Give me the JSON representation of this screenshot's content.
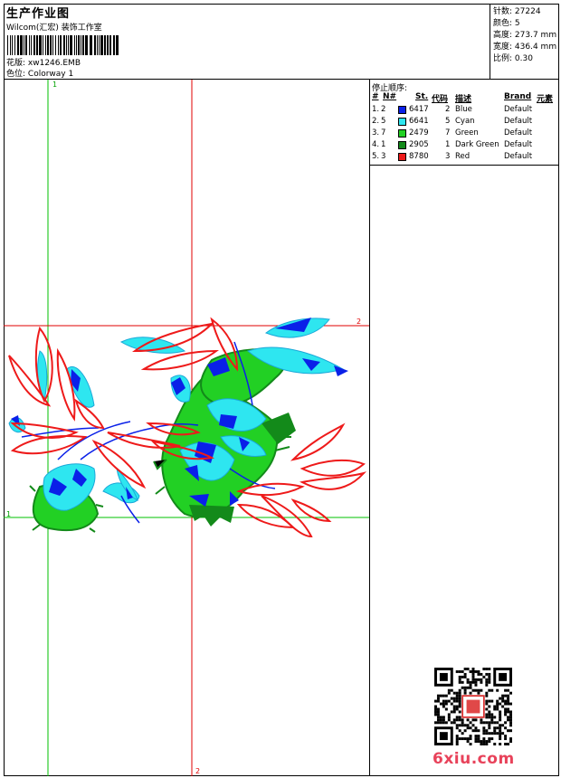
{
  "header": {
    "title": "生产作业图",
    "studio": "Wilcom(汇宏) 装饰工作室",
    "design_label": "花版:",
    "design_value": "xw1246.EMB",
    "colorway_label": "色位:",
    "colorway_value": "Colorway 1"
  },
  "stats": [
    {
      "label": "针数:",
      "value": "27224"
    },
    {
      "label": "颜色:",
      "value": "5"
    },
    {
      "label": "高度:",
      "value": "273.7 mm"
    },
    {
      "label": "宽度:",
      "value": "436.4 mm"
    },
    {
      "label": "比例:",
      "value": "0.30"
    }
  ],
  "stop_sequence": {
    "title": "停止顺序:",
    "columns": [
      "#",
      "N#",
      "St.",
      "代码",
      "描述",
      "Brand",
      "元素"
    ],
    "rows": [
      {
        "idx": "1.",
        "n": "2",
        "st": "6417",
        "code": "2",
        "desc": "Blue",
        "brand": "Default",
        "color": "#0a20e8"
      },
      {
        "idx": "2.",
        "n": "5",
        "st": "6641",
        "code": "5",
        "desc": "Cyan",
        "brand": "Default",
        "color": "#2ee6f0"
      },
      {
        "idx": "3.",
        "n": "7",
        "st": "2479",
        "code": "7",
        "desc": "Green",
        "brand": "Default",
        "color": "#22d024"
      },
      {
        "idx": "4.",
        "n": "1",
        "st": "2905",
        "code": "1",
        "desc": "Dark Green",
        "brand": "Default",
        "color": "#138a1a"
      },
      {
        "idx": "5.",
        "n": "3",
        "st": "8780",
        "code": "3",
        "desc": "Red",
        "brand": "Default",
        "color": "#ee1a1a"
      }
    ]
  },
  "guides": {
    "label_1": "1",
    "label_2": "2",
    "green": "#00c000",
    "red": "#e00000"
  },
  "watermark": {
    "text": "6xiu.com"
  }
}
